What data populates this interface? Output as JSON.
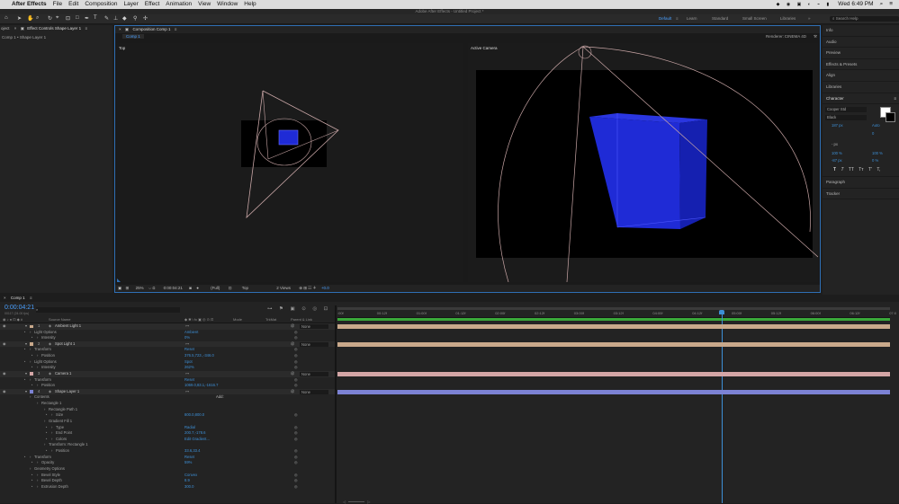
{
  "menubar": {
    "app": "After Effects",
    "items": [
      "File",
      "Edit",
      "Composition",
      "Layer",
      "Effect",
      "Animation",
      "View",
      "Window",
      "Help"
    ],
    "clock": "Wed 6:49 PM"
  },
  "window_title": "Adobe After Effects - Untitled Project *",
  "workspaces": [
    "Default",
    "Learn",
    "Standard",
    "Small Screen",
    "Libraries"
  ],
  "search_help": "Search Help",
  "project_panel": {
    "label": "oject"
  },
  "effect_controls": {
    "tab": "Effect Controls Shape Layer 1",
    "breadcrumb": "Comp 1 • Shape Layer 1"
  },
  "composition_panel": {
    "tab": "Composition Comp 1",
    "subtab": "Comp 1",
    "renderer_label": "Renderer:",
    "renderer": "CINEMA 4D"
  },
  "views": {
    "left": "Top",
    "right": "Active Camera"
  },
  "viewer_footer": {
    "zoom": "25%",
    "time": "0:00:04:21",
    "resolution": "(Full)",
    "view": "Top",
    "layout": "2 Views",
    "exposure": "+0.0"
  },
  "right_panels": [
    "Info",
    "Audio",
    "Preview",
    "Effects & Presets",
    "Align",
    "Libraries",
    "Character",
    "Paragraph",
    "Tracker"
  ],
  "character": {
    "font": "Cooper Std",
    "style": "Black",
    "size": "187 px",
    "leading": "Auto",
    "tracking": "0",
    "stroke": "- px",
    "vscale": "100 %",
    "hscale": "100 %",
    "baseline": "-87 px",
    "tsume": "0 %",
    "styles": [
      "T",
      "T",
      "TT",
      "Tт",
      "T'",
      "T,"
    ]
  },
  "timeline": {
    "tab": "Comp 1",
    "time": "0:00:04:21",
    "fps": "00117 (24.00 fps)",
    "columns": {
      "name": "Source Name",
      "mode": "Mode",
      "trkmat": "TrkMat",
      "parent": "Parent & Link"
    },
    "ticks": [
      ":00f",
      "00:12f",
      "01:00f",
      "01:12f",
      "02:00f",
      "02:12f",
      "03:00f",
      "03:12f",
      "04:00f",
      "04:12f",
      "05:00f",
      "05:12f",
      "06:00f",
      "06:12f",
      "07:0"
    ],
    "add_label": "Add:",
    "rows": [
      {
        "indent": 0,
        "num": "1",
        "name": "Ambient Light 1",
        "swatch": "#c9a98b",
        "parent": "None",
        "kind": "layer"
      },
      {
        "indent": 1,
        "name": "Light Options",
        "value": "Ambient",
        "kind": "prop"
      },
      {
        "indent": 2,
        "name": "Intensity",
        "value": "0%",
        "kind": "prop"
      },
      {
        "indent": 0,
        "num": "2",
        "name": "Spot Light 1",
        "swatch": "#c9a98b",
        "parent": "None",
        "kind": "layer"
      },
      {
        "indent": 1,
        "name": "Transform",
        "value": "Reset",
        "kind": "prop"
      },
      {
        "indent": 2,
        "name": "Position",
        "value": "376.5,723.,-346.0",
        "kind": "prop"
      },
      {
        "indent": 1,
        "name": "Light Options",
        "value": "Spot",
        "kind": "prop"
      },
      {
        "indent": 2,
        "name": "Intensity",
        "value": "262%",
        "kind": "prop"
      },
      {
        "indent": 0,
        "num": "3",
        "name": "Camera 1",
        "swatch": "#d4a6a6",
        "parent": "None",
        "kind": "layer"
      },
      {
        "indent": 1,
        "name": "Transform",
        "value": "Reset",
        "kind": "prop"
      },
      {
        "indent": 2,
        "name": "Position",
        "value": "1069.0,83.1,-1616.7",
        "kind": "prop"
      },
      {
        "indent": 0,
        "num": "4",
        "name": "Shape Layer 1",
        "swatch": "#7c82d4",
        "parent": "None",
        "kind": "layer"
      },
      {
        "indent": 1,
        "name": "Contents",
        "value": "",
        "kind": "prop"
      },
      {
        "indent": 2,
        "name": "Rectangle 1",
        "value": "",
        "kind": "prop"
      },
      {
        "indent": 3,
        "name": "Rectangle Path 1",
        "value": "",
        "kind": "prop"
      },
      {
        "indent": 4,
        "name": "Size",
        "value": "800.0,800.0",
        "kind": "prop"
      },
      {
        "indent": 3,
        "name": "Gradient Fill 1",
        "value": "",
        "kind": "prop"
      },
      {
        "indent": 4,
        "name": "Type",
        "value": "Radial",
        "kind": "prop"
      },
      {
        "indent": 4,
        "name": "End Point",
        "value": "200.7,-178.6",
        "kind": "prop"
      },
      {
        "indent": 4,
        "name": "Colors",
        "value": "Edit Gradient...",
        "kind": "prop"
      },
      {
        "indent": 3,
        "name": "Transform: Rectangle 1",
        "value": "",
        "kind": "prop"
      },
      {
        "indent": 4,
        "name": "Position",
        "value": "33.6,33.4",
        "kind": "prop"
      },
      {
        "indent": 1,
        "name": "Transform",
        "value": "Reset",
        "kind": "prop"
      },
      {
        "indent": 2,
        "name": "Opacity",
        "value": "59%",
        "kind": "prop"
      },
      {
        "indent": 1,
        "name": "Geometry Options",
        "value": "",
        "kind": "prop"
      },
      {
        "indent": 2,
        "name": "Bevel Style",
        "value": "Convex",
        "kind": "prop"
      },
      {
        "indent": 2,
        "name": "Bevel Depth",
        "value": "8.9",
        "kind": "prop"
      },
      {
        "indent": 2,
        "name": "Extrusion Depth",
        "value": "300.0",
        "kind": "prop"
      }
    ]
  },
  "colors": {
    "accent": "#2f6fb5",
    "cube": "#1f2bd6",
    "ambient": "#c9a98b",
    "camera": "#d4a6a6",
    "shape": "#7c82d4",
    "playhead": "#3d8fd6"
  }
}
